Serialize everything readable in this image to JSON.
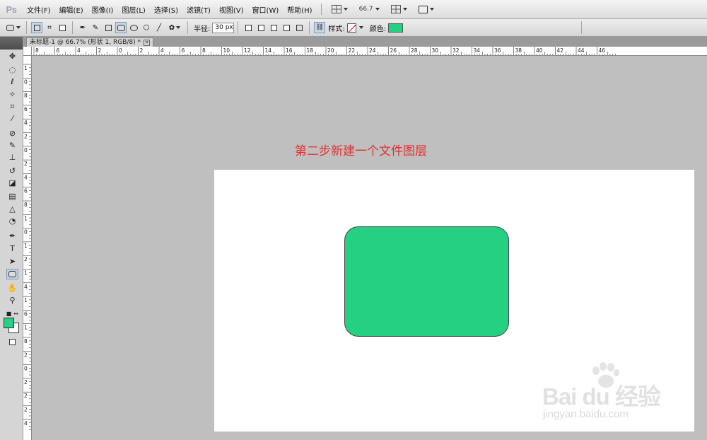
{
  "app": {
    "logo": "Ps"
  },
  "menubar": {
    "items": [
      "文件(F)",
      "编辑(E)",
      "图像(I)",
      "图层(L)",
      "选择(S)",
      "滤镜(T)",
      "视图(V)",
      "窗口(W)",
      "帮助(H)"
    ],
    "zoom": "66.7"
  },
  "options": {
    "radius_label": "半径:",
    "radius_value": "30 px",
    "style_label": "样式:",
    "color_label": "颜色:",
    "shape_color": "#26d083"
  },
  "document": {
    "tab_title": "未标题-1 @ 66.7% (形状 1, RGB/8) *",
    "caption": "第二步新建一个文件图层",
    "caption_color": "#e03030",
    "canvas_color": "#ffffff",
    "shape_fill": "#26d083"
  },
  "rulers": {
    "h_labels": [
      "8",
      "6",
      "4",
      "2",
      "0",
      "2",
      "4",
      "6",
      "8",
      "10",
      "12",
      "14",
      "16",
      "18",
      "20",
      "22",
      "24",
      "26",
      "28",
      "30",
      "32",
      "34",
      "36",
      "38",
      "40",
      "42",
      "44",
      "46"
    ],
    "v_labels": [
      "1",
      "0",
      "8",
      "6",
      "4",
      "2",
      "0",
      "2",
      "4",
      "6",
      "8",
      "1",
      "0",
      "1",
      "2",
      "1",
      "4",
      "1",
      "6",
      "1",
      "8",
      "2",
      "0",
      "2",
      "2",
      "2",
      "4"
    ]
  },
  "toolbar": {
    "tools": [
      "move-tool",
      "marquee-tool",
      "lasso-tool",
      "quick-select-tool",
      "crop-tool",
      "eyedropper-tool",
      "healing-tool",
      "brush-tool",
      "clone-stamp-tool",
      "history-brush-tool",
      "eraser-tool",
      "gradient-tool",
      "blur-tool",
      "dodge-tool",
      "pen-tool",
      "type-tool",
      "path-select-tool",
      "rounded-rectangle-tool",
      "hand-tool",
      "zoom-tool"
    ],
    "foreground_color": "#26d083",
    "background_color": "#ffffff"
  },
  "watermark": {
    "logo": "Bai du 经验",
    "url": "jingyan.baidu.com"
  }
}
